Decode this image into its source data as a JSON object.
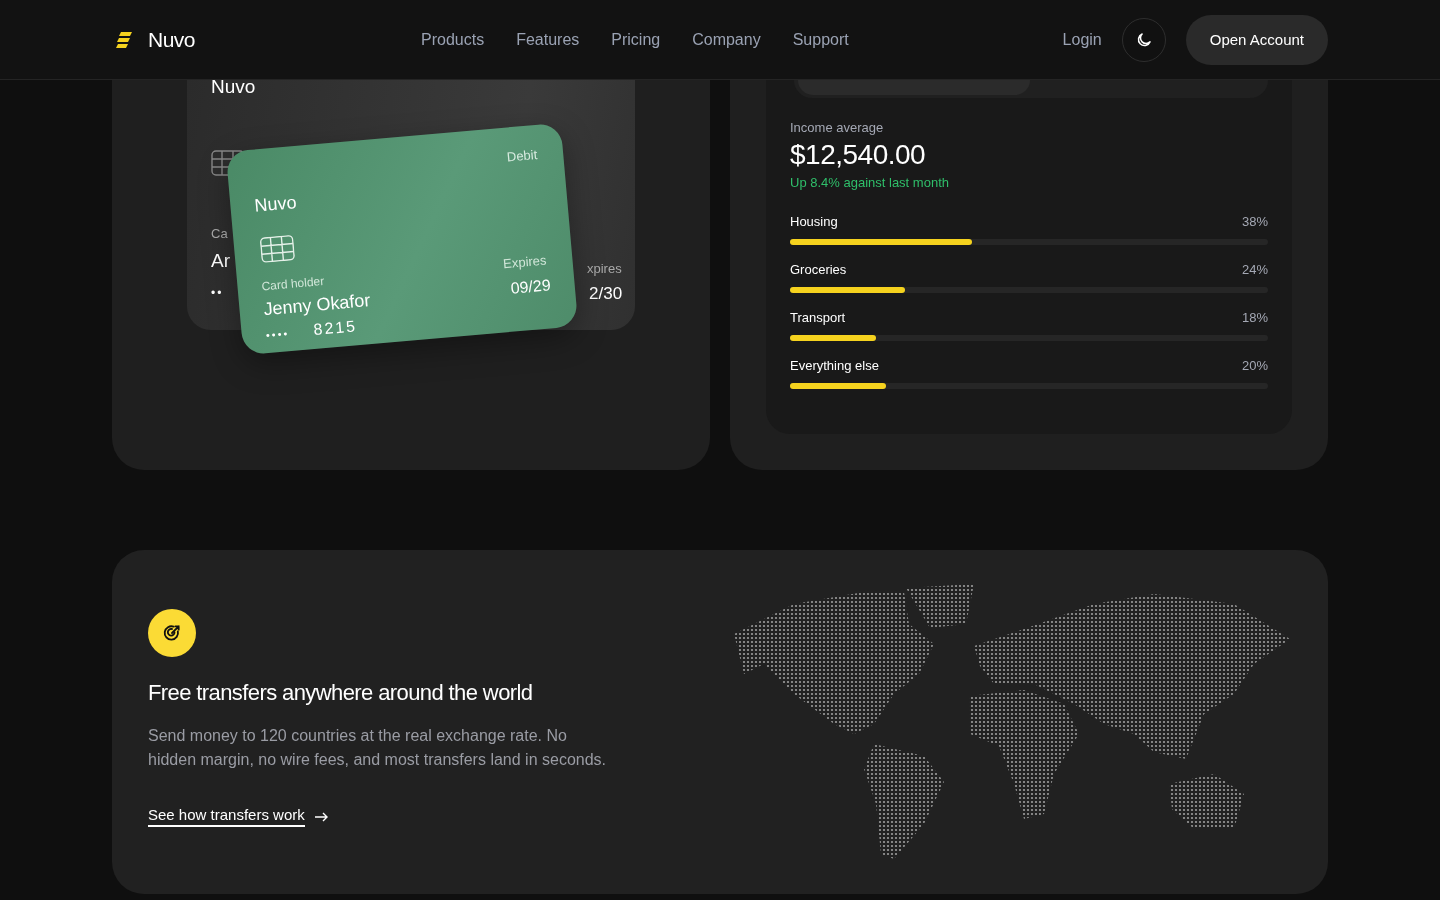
{
  "nav": {
    "brand": "Nuvo",
    "links": [
      "Products",
      "Features",
      "Pricing",
      "Company",
      "Support"
    ],
    "login": "Login",
    "cta": "Open Account"
  },
  "back_card": {
    "brand": "Nuvo",
    "label_part": "Ca",
    "name_part": "Ar",
    "number_part": "••",
    "expires_label_part": "xpires",
    "expires_part": "2/30"
  },
  "front_card": {
    "brand": "Nuvo",
    "type": "Debit",
    "holder_label": "Card holder",
    "holder": "Jenny Okafor",
    "mask": "••••",
    "last_digits": "8215",
    "expires_label": "Expires",
    "expires": "09/29"
  },
  "income": {
    "label": "Income average",
    "amount": "$12,540.00",
    "change": "Up 8.4% against last month",
    "categories": [
      {
        "name": "Housing",
        "percent": "38%",
        "level": 0.38
      },
      {
        "name": "Groceries",
        "percent": "24%",
        "level": 0.24
      },
      {
        "name": "Transport",
        "percent": "18%",
        "level": 0.18
      },
      {
        "name": "Everything else",
        "percent": "20%",
        "level": 0.2
      }
    ]
  },
  "feature": {
    "title": "Free transfers anywhere around the world",
    "body": "Send money to 120 countries at the real exchange rate. No hidden margin, no wire fees, and most transfers land in seconds.",
    "link": "See how transfers work"
  }
}
